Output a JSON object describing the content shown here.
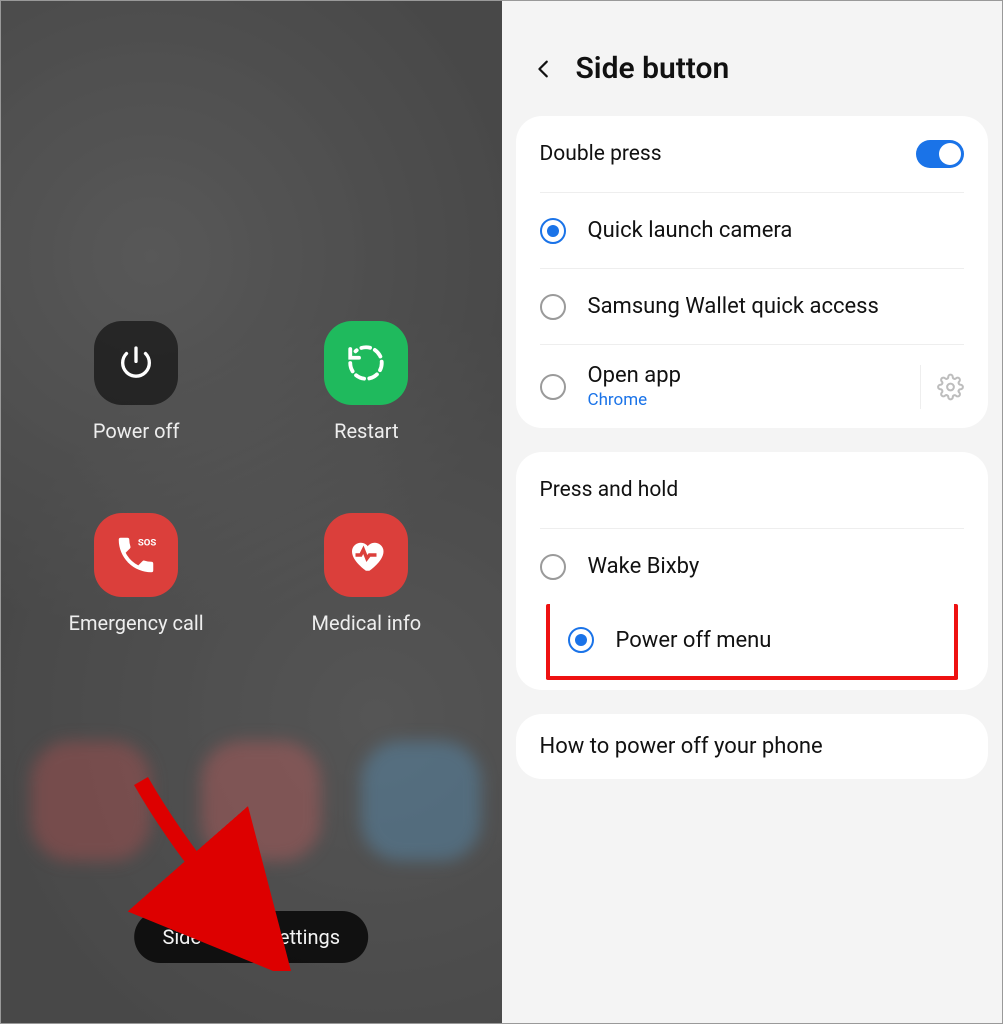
{
  "left": {
    "items": [
      {
        "label": "Power off"
      },
      {
        "label": "Restart"
      },
      {
        "label": "Emergency call"
      },
      {
        "label": "Medical info"
      }
    ],
    "pill_label": "Side button settings"
  },
  "right": {
    "title": "Side button",
    "double_press": {
      "header": "Double press",
      "toggle_on": true,
      "options": [
        {
          "label": "Quick launch camera",
          "selected": true
        },
        {
          "label": "Samsung Wallet quick access",
          "selected": false
        },
        {
          "label": "Open app",
          "sub": "Chrome",
          "selected": false,
          "has_settings": true
        }
      ]
    },
    "press_hold": {
      "header": "Press and hold",
      "options": [
        {
          "label": "Wake Bixby",
          "selected": false
        },
        {
          "label": "Power off menu",
          "selected": true,
          "highlighted": true
        }
      ]
    },
    "info": "How to power off your phone"
  }
}
